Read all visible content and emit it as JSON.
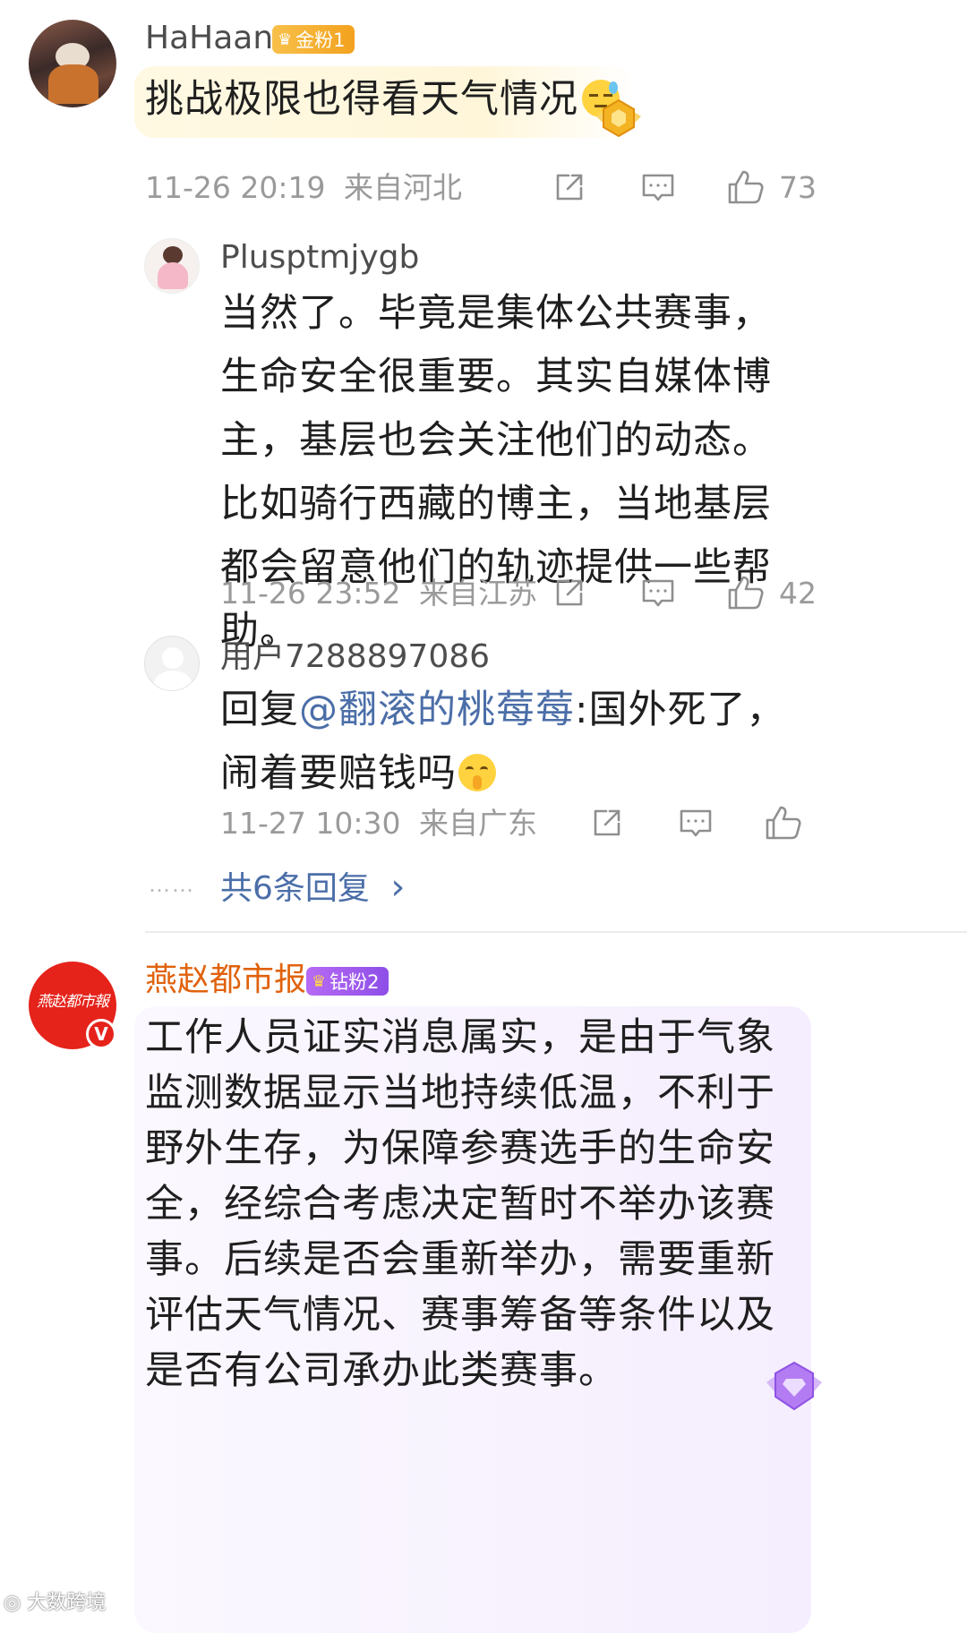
{
  "comment1": {
    "username": "HaHaan-",
    "badge": "金粉1",
    "text": "挑战极限也得看天气情况",
    "time": "11-26 20:19",
    "location": "来自河北",
    "likes": "73"
  },
  "reply1": {
    "username": "Plusptmjygb",
    "text": "当然了。毕竟是集体公共赛事，生命安全很重要。其实自媒体博主，基层也会关注他们的动态。比如骑行西藏的博主，当地基层都会留意他们的轨迹提供一些帮助。",
    "time": "11-26 23:52",
    "location": "来自江苏",
    "likes": "42"
  },
  "reply2": {
    "username": "用户7288897086",
    "prefix": "回复",
    "mention": "@翻滚的桃莓莓",
    "text": ":国外死了，闹着要赔钱吗",
    "time": "11-27 10:30",
    "location": "来自广东"
  },
  "more_replies": {
    "dots": "……",
    "label": "共6条回复",
    "chevron": "›"
  },
  "comment2": {
    "username": "燕赵都市报",
    "avatar_text": "燕赵都市報",
    "verified_mark": "V",
    "badge": "钻粉2",
    "text": "工作人员证实消息属实，是由于气象监测数据显示当地持续低温，不利于野外生存，为保障参赛选手的生命安全，经综合考虑决定暂时不举办该赛事。后续是否会重新举办，需要重新评估天气情况、赛事筹备等条件以及是否有公司承办此类赛事。"
  },
  "watermark": "大数跨境",
  "colors": {
    "meta": "#9a9a9a",
    "mention": "#4b6ea8",
    "name_highlight": "#e0620d",
    "gold_badge": "#f3a21e",
    "purple_badge": "#8d4fe8"
  }
}
